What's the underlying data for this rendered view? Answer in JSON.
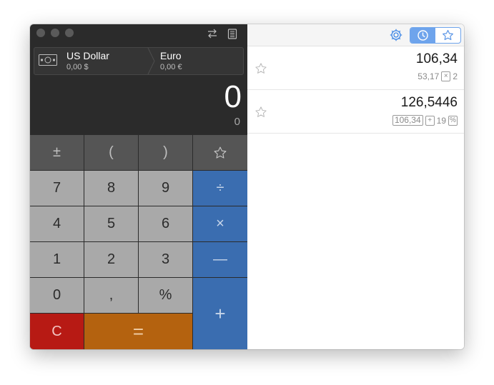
{
  "converter": {
    "from_currency": {
      "name": "US Dollar",
      "value": "0,00 $"
    },
    "to_currency": {
      "name": "Euro",
      "value": "0,00 €"
    }
  },
  "display": {
    "main": "0",
    "secondary": "0"
  },
  "keys": {
    "plus_minus": "±",
    "paren_open": "(",
    "paren_close": ")",
    "favorite": "☆",
    "seven": "7",
    "eight": "8",
    "nine": "9",
    "divide": "÷",
    "four": "4",
    "five": "5",
    "six": "6",
    "multiply": "×",
    "one": "1",
    "two": "2",
    "three": "3",
    "minus": "—",
    "zero": "0",
    "comma": ",",
    "percent": "%",
    "plus": "+",
    "clear": "C",
    "equals": "="
  },
  "history": [
    {
      "result": "106,34",
      "operand_a": "53,17",
      "operator": "×",
      "operand_b": "2"
    },
    {
      "result": "126,5446",
      "operand_a": "106,34",
      "operator": "+",
      "operand_b": "19",
      "suffix": "%"
    }
  ],
  "colors": {
    "accent": "#6ea4ec",
    "key_blue": "#3a6db0",
    "key_red": "#b71a14",
    "key_orange": "#b4620f"
  }
}
